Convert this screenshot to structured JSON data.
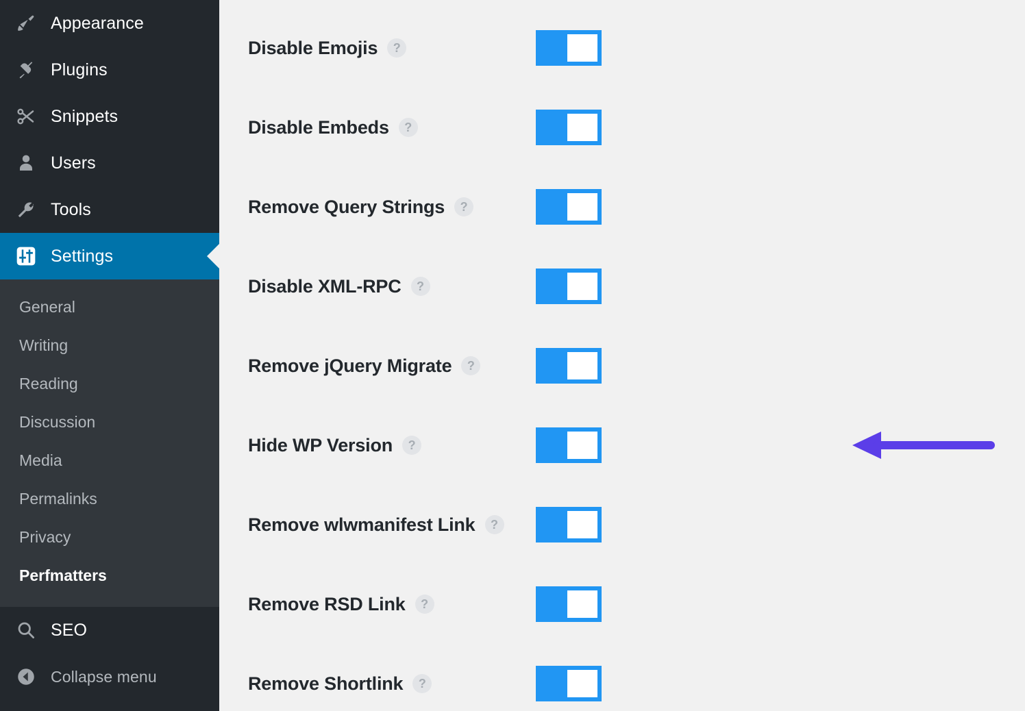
{
  "sidebar": {
    "top_items": [
      {
        "label": "Appearance",
        "icon": "paintbrush-icon"
      },
      {
        "label": "Plugins",
        "icon": "plug-icon"
      },
      {
        "label": "Snippets",
        "icon": "scissors-icon"
      },
      {
        "label": "Users",
        "icon": "user-icon"
      },
      {
        "label": "Tools",
        "icon": "wrench-icon"
      },
      {
        "label": "Settings",
        "icon": "settings-sliders-icon",
        "active": true
      }
    ],
    "submenu_items": [
      {
        "label": "General"
      },
      {
        "label": "Writing"
      },
      {
        "label": "Reading"
      },
      {
        "label": "Discussion"
      },
      {
        "label": "Media"
      },
      {
        "label": "Permalinks"
      },
      {
        "label": "Privacy"
      },
      {
        "label": "Perfmatters",
        "current": true
      }
    ],
    "bottom_items": [
      {
        "label": "SEO",
        "icon": "search-icon"
      },
      {
        "label": "Collapse menu",
        "icon": "collapse-left-icon"
      }
    ]
  },
  "main": {
    "help_glyph": "?",
    "settings": [
      {
        "label": "Disable Emojis",
        "enabled": true
      },
      {
        "label": "Disable Embeds",
        "enabled": true
      },
      {
        "label": "Remove Query Strings",
        "enabled": true
      },
      {
        "label": "Disable XML-RPC",
        "enabled": true
      },
      {
        "label": "Remove jQuery Migrate",
        "enabled": true
      },
      {
        "label": "Hide WP Version",
        "enabled": true,
        "annotated": true
      },
      {
        "label": "Remove wlwmanifest Link",
        "enabled": true
      },
      {
        "label": "Remove RSD Link",
        "enabled": true
      },
      {
        "label": "Remove Shortlink",
        "enabled": true
      }
    ]
  },
  "colors": {
    "sidebar_bg": "#23282d",
    "submenu_bg": "#32373c",
    "active_menu": "#0073aa",
    "content_bg": "#f1f1f1",
    "toggle_on": "#2196f3",
    "annotation_arrow": "#5b3ee8",
    "label_text": "#23282d",
    "help_icon_bg": "#e2e4e7"
  }
}
